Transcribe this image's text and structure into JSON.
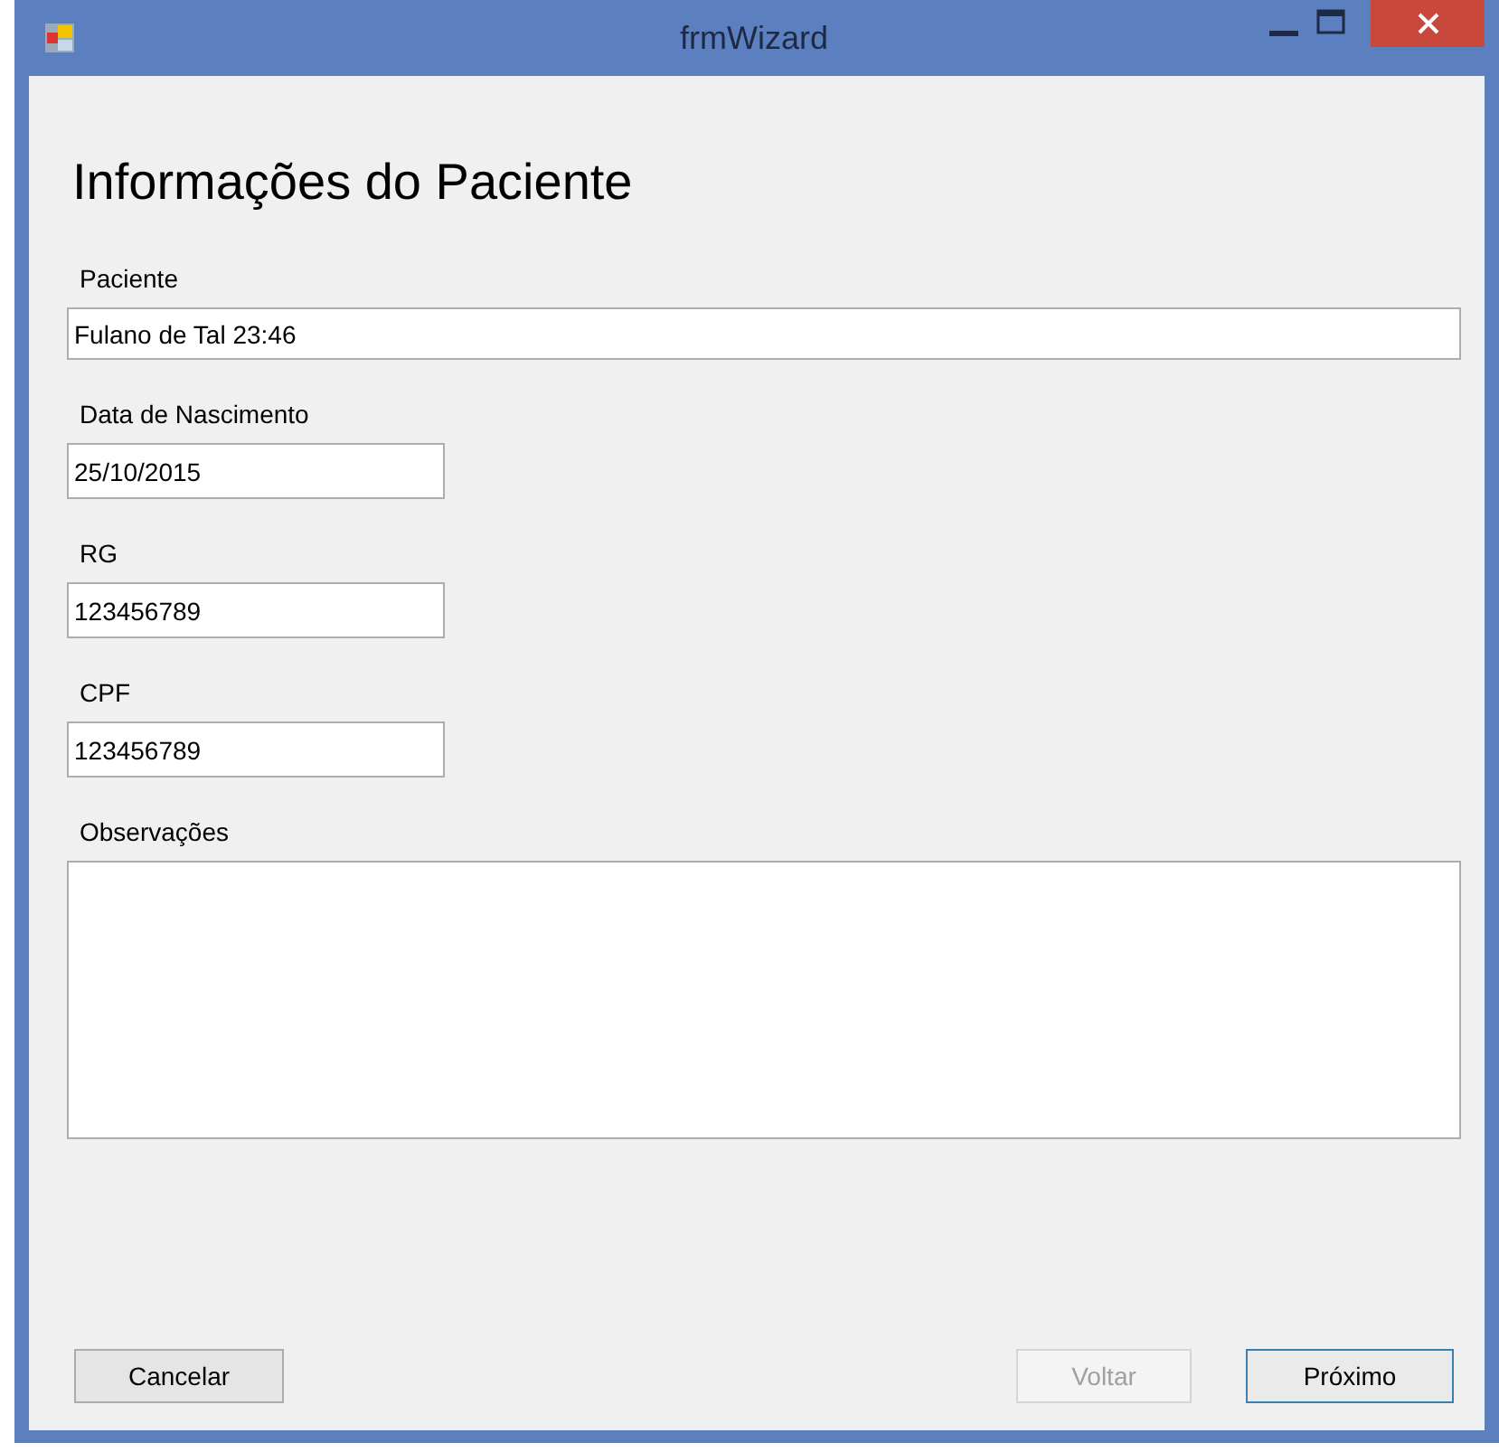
{
  "window": {
    "title": "frmWizard"
  },
  "heading": "Informações do Paciente",
  "fields": [
    {
      "label": "Paciente",
      "value": "Fulano de Tal 23:46",
      "kind": "wide"
    },
    {
      "label": "Data de Nascimento",
      "value": "25/10/2015",
      "kind": "short"
    },
    {
      "label": "RG",
      "value": "123456789",
      "kind": "short"
    },
    {
      "label": "CPF",
      "value": "123456789",
      "kind": "short"
    },
    {
      "label": "Observações",
      "kind": "multiline"
    }
  ],
  "buttons": [
    {
      "label": "Cancelar",
      "disabled": false,
      "focused": false
    },
    {
      "label": "Voltar",
      "disabled": true,
      "focused": false
    },
    {
      "label": "Próximo",
      "disabled": false,
      "focused": true
    }
  ]
}
